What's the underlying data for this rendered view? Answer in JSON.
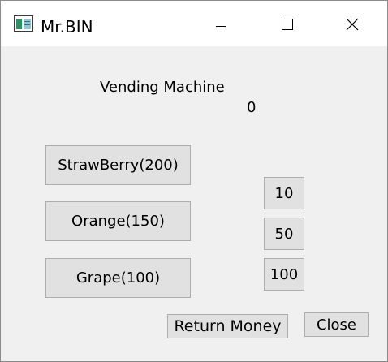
{
  "window": {
    "title": "Mr.BIN",
    "icon": "application-window-icon"
  },
  "caption_buttons": {
    "minimize_icon": "minimize-icon",
    "maximize_icon": "maximize-icon",
    "close_icon": "close-icon"
  },
  "main": {
    "heading": "Vending Machine",
    "balance": "0"
  },
  "products": [
    {
      "label": "StrawBerry(200)"
    },
    {
      "label": "Orange(150)"
    },
    {
      "label": "Grape(100)"
    }
  ],
  "coins": [
    {
      "label": "10"
    },
    {
      "label": "50"
    },
    {
      "label": "100"
    }
  ],
  "actions": {
    "return_label": "Return Money",
    "close_label": "Close"
  }
}
